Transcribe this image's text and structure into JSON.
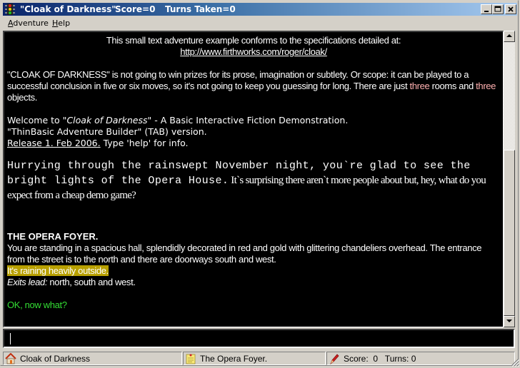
{
  "window": {
    "title": "\"Cloak of Darkness\"",
    "title_score": "Score=0",
    "title_turns": "Turns Taken=0",
    "controls": {
      "minimize": "_",
      "maximize": "□",
      "close": "×"
    }
  },
  "menu": [
    {
      "label": "Adventure",
      "accel": "A",
      "rest": "dventure"
    },
    {
      "label": "Help",
      "accel": "H",
      "rest": "elp"
    }
  ],
  "output": {
    "intro_line": "This small text adventure example conforms to the specifications detailed at:",
    "intro_link": "http://www.firthworks.com/roger/cloak/",
    "para2_a": "\"CLOAK OF DARKNESS\" is not going to win prizes for its prose, imagination or subtlety. Or scope: it can be played to a successful conclusion in five or six moves, so it's not going to keep you guessing for long. There are just ",
    "para2_three1": "three",
    "para2_b": " rooms and ",
    "para2_three2": "three",
    "para2_c": " objects.",
    "welcome_a": "Welcome to \"",
    "welcome_title": "Cloak of Darkness",
    "welcome_b": "\" - A Basic Interactive Fiction Demonstration.",
    "version_line": "\"ThinBasic Adventure Builder\" (TAB) version.",
    "release": "Release 1. Feb 2006.",
    "release_help": " Type 'help' for info.",
    "story_mono": "Hurrying through the rainswept November night, you`re glad to see the bright lights of the Opera House.",
    "story_serif": " It`s surprising there aren`t more people about but, hey, what do you expect from a cheap demo game?",
    "room_title": "THE OPERA FOYER.",
    "room_desc": "You are standing in a spacious hall, splendidly decorated in red and gold with glittering chandeliers overhead. The entrance from the street is to the north and there are doorways south and west.",
    "weather": "It's raining heavily outside.",
    "exits_label": "Exits lead:",
    "exits": " north, south and west.",
    "prompt": "OK, now what?"
  },
  "input": {
    "value": ""
  },
  "status": {
    "pane1": {
      "icon": "home-icon",
      "text": "Cloak of Darkness"
    },
    "pane2": {
      "icon": "note-icon",
      "text": "The Opera Foyer."
    },
    "pane3": {
      "icon": "pen-icon",
      "text": "Score:  0   Turns: 0"
    }
  },
  "colors": {
    "accent_pink": "#ffb0b0",
    "highlight": "#b8a000",
    "prompt_green": "#33dd33"
  }
}
